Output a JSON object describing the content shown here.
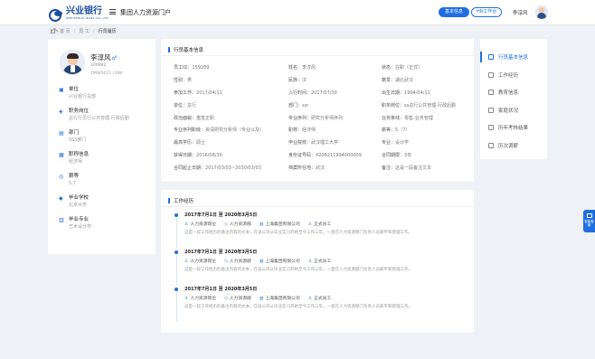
{
  "header": {
    "logo_text": "兴业银行",
    "logo_sub": "INDUSTRIAL BANK CO.,LTD.",
    "system_title": "集团人力资源门户",
    "btn_basic": "基本信息",
    "btn_hr": "HR工作台",
    "user_name": "李淳风"
  },
  "breadcrumb": [
    "首 页",
    "员 工",
    "行员履历"
  ],
  "profile": {
    "name": "李淳风",
    "gender_symbol": "♂",
    "id": "100992",
    "meta": "1994/04/11  |  28岁",
    "items": [
      {
        "label": "单位",
        "value": "兴业银行总部"
      },
      {
        "label": "职务岗位",
        "value": "总行行员行公共管理-行政后勤"
      },
      {
        "label": "部门",
        "value": "SSS部门"
      },
      {
        "label": "职称信息",
        "value": "经济师"
      },
      {
        "label": "薪等",
        "value": "5.7"
      },
      {
        "label": "毕业学校",
        "value": "北京大学"
      },
      {
        "label": "毕业专业",
        "value": "艺术设计学"
      }
    ]
  },
  "basic": {
    "title": "行员基本信息",
    "rows": [
      [
        {
          "k": "员工ID：",
          "v": "159289"
        },
        {
          "k": "姓名：",
          "v": "李淳风"
        },
        {
          "k": "状态：",
          "v": "在职（正式）"
        }
      ],
      [
        {
          "k": "性别：",
          "v": "男"
        },
        {
          "k": "民族：",
          "v": "汉"
        },
        {
          "k": "籍贯：",
          "v": "湖北武汉"
        }
      ],
      [
        {
          "k": "参加工作：",
          "v": "2017/04/11"
        },
        {
          "k": "入行时间：",
          "v": "2017/07/30"
        },
        {
          "k": "出生日期：",
          "v": "1994/04/11"
        }
      ],
      [
        {
          "k": "单位：",
          "v": "总行"
        },
        {
          "k": "部门：",
          "v": "ssr"
        },
        {
          "k": "职务岗位：",
          "v": "ss总行公共管理-行政后勤"
        }
      ],
      [
        {
          "k": "政治面貌：",
          "v": "重签正职"
        },
        {
          "k": "专业序列：",
          "v": "研究分析师序列"
        },
        {
          "k": "业务条线：",
          "v": "零售-业务管理"
        }
      ],
      [
        {
          "k": "专业序列职级：",
          "v": "资深研究分析师（专业以及）"
        },
        {
          "k": "职称：",
          "v": "经济师"
        },
        {
          "k": "薪等：",
          "v": "5（7）"
        }
      ],
      [
        {
          "k": "最高学历：",
          "v": "硕士"
        },
        {
          "k": "毕业院校：",
          "v": "武汉理工大学"
        },
        {
          "k": "专业：",
          "v": "设计学"
        }
      ],
      [
        {
          "k": "获得日期：",
          "v": "2016/06/30"
        },
        {
          "k": "身份证号码：",
          "v": "4208211994000009"
        },
        {
          "k": "合同期限：",
          "v": "3年"
        }
      ],
      [
        {
          "k": "合同起止日期：",
          "v": "2017/03/03~2030/03/03"
        },
        {
          "k": "档案所在地：",
          "v": "武汉"
        },
        {
          "k": "备注：",
          "v": "这是一段备注文本"
        }
      ]
    ]
  },
  "work": {
    "title": "工作经历",
    "items": [
      {
        "date": "2017年7月1日  至  2020年3月5日",
        "tags": [
          "人力资源岗位",
          "人力资源部",
          "上海集团有限公司",
          "正式员工"
        ],
        "desc": "这是一段工作经历的备注内容的文本，在该公司从毕业实习开始至今工作三年，一直在人力资源部门负责人员薪平和管理工作。"
      },
      {
        "date": "2017年7月1日  至  2020年3月5日",
        "tags": [
          "人力资源岗位",
          "人力资源部",
          "上海集团有限公司",
          "正式员工"
        ],
        "desc": "这是一段工作经历的备注内容的文本，在该公司从毕业实习开始至今工作三年，一直在人力资源部门负责人员薪平和管理工作。"
      },
      {
        "date": "2017年7月1日  至  2020年3月5日",
        "tags": [
          "人力资源岗位",
          "人力资源部",
          "上海集团有限公司",
          "正式员工"
        ],
        "desc": "这是一段工作经历的备注内容的文本，在该公司从毕业实习开始至今工作三年，一直在人力资源部门负责人员薪平和管理工作。"
      }
    ]
  },
  "nav": {
    "items": [
      "行员基本信息",
      "工作经历",
      "教育信息",
      "家庭状况",
      "历年考核结果",
      "历次调薪"
    ],
    "active_index": 0
  },
  "float_button": {
    "label": "智能客服"
  },
  "colors": {
    "accent": "#1f6fe0",
    "background": "#eef1f5"
  }
}
